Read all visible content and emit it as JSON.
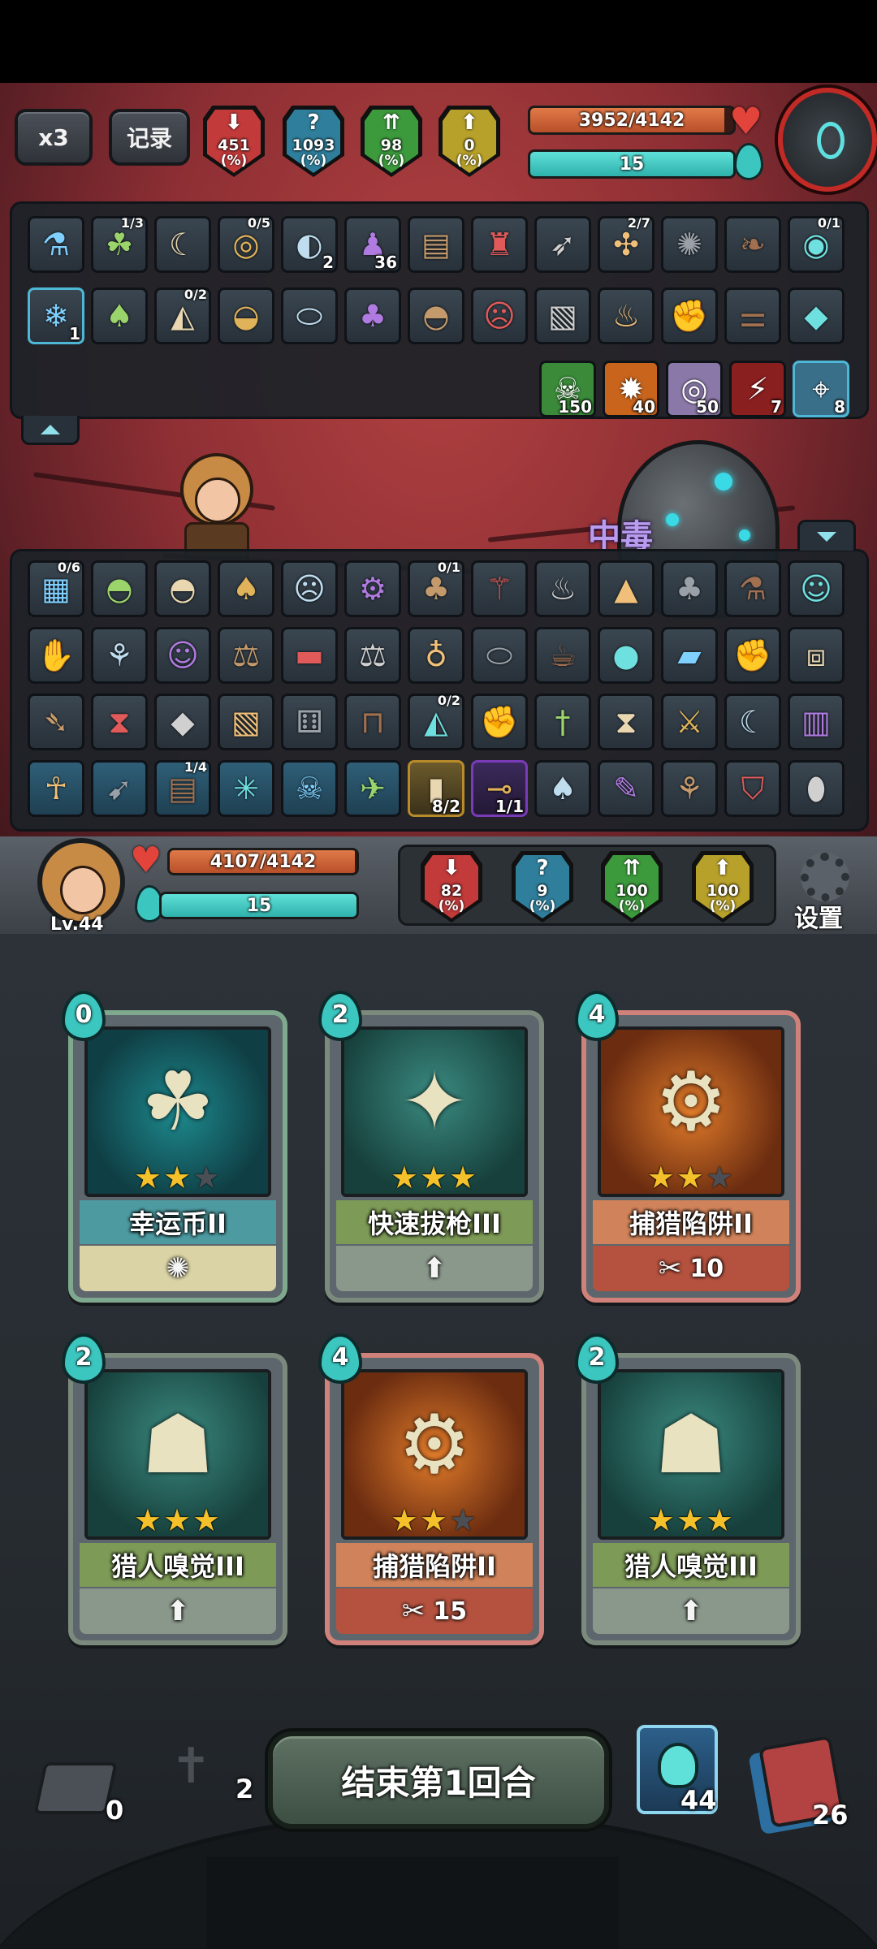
{
  "top_hud": {
    "speed_label": "x3",
    "record_label": "记录",
    "enemy_stats": [
      {
        "value": "451",
        "unit": "(%)",
        "color": "#c23a3a",
        "icon": "arrow-down-icon"
      },
      {
        "value": "1093",
        "unit": "(%)",
        "color": "#2f7f9c",
        "icon": "question-icon"
      },
      {
        "value": "98",
        "unit": "(%)",
        "color": "#3c9a3c",
        "icon": "arrows-up-icon"
      },
      {
        "value": "0",
        "unit": "(%)",
        "color": "#b8a12a",
        "icon": "arrow-up-icon"
      }
    ],
    "enemy_hp": "3952/4142",
    "enemy_hp_ratio": 0.954,
    "enemy_energy": "15",
    "enemy_energy_ratio": 1.0
  },
  "enemy_items_row1": [
    {
      "icon": "blue-potion-icon",
      "count": "",
      "frac": ""
    },
    {
      "icon": "plant-icon",
      "count": "",
      "frac": "1/3"
    },
    {
      "icon": "claw-icon",
      "count": "",
      "frac": ""
    },
    {
      "icon": "ring-icon",
      "count": "",
      "frac": "0/5"
    },
    {
      "icon": "moon-orb-icon",
      "count": "2",
      "frac": ""
    },
    {
      "icon": "purple-figure-icon",
      "count": "36",
      "frac": ""
    },
    {
      "icon": "book-icon",
      "count": "",
      "frac": ""
    },
    {
      "icon": "red-creature-icon",
      "count": "",
      "frac": ""
    },
    {
      "icon": "arrows-icon",
      "count": "",
      "frac": ""
    },
    {
      "icon": "compass-icon",
      "count": "",
      "frac": "2/7"
    },
    {
      "icon": "fan-icon",
      "count": "",
      "frac": ""
    },
    {
      "icon": "wing-icon",
      "count": "",
      "frac": ""
    },
    {
      "icon": "eye-orb-icon",
      "count": "",
      "frac": "0/1"
    }
  ],
  "enemy_items_row2": [
    {
      "icon": "snowflake-icon",
      "count": "1",
      "frac": ""
    },
    {
      "icon": "hood-icon",
      "count": "",
      "frac": ""
    },
    {
      "icon": "armor-icon",
      "count": "",
      "frac": "0/2"
    },
    {
      "icon": "bowl-icon",
      "count": "",
      "frac": ""
    },
    {
      "icon": "bread-icon",
      "count": "",
      "frac": ""
    },
    {
      "icon": "pouch-icon",
      "count": "",
      "frac": ""
    },
    {
      "icon": "helmet-icon",
      "count": "",
      "frac": ""
    },
    {
      "icon": "mask-icon",
      "count": "",
      "frac": ""
    },
    {
      "icon": "scroll-icon",
      "count": "",
      "frac": ""
    },
    {
      "icon": "fire-apple-icon",
      "count": "",
      "frac": ""
    },
    {
      "icon": "glove-icon",
      "count": "",
      "frac": ""
    },
    {
      "icon": "bone-icon",
      "count": "",
      "frac": ""
    },
    {
      "icon": "crystal-icon",
      "count": "",
      "frac": ""
    }
  ],
  "enemy_effects": [
    {
      "icon": "poison-skull-icon",
      "count": "150"
    },
    {
      "icon": "burn-icon",
      "count": "40"
    },
    {
      "icon": "vortex-icon",
      "count": "50"
    },
    {
      "icon": "bleed-icon",
      "count": "7"
    },
    {
      "icon": "target-icon",
      "count": "8"
    }
  ],
  "status_popup": "中毒",
  "player_items": [
    [
      {
        "icon": "map-icon",
        "frac": "0/6",
        "style": ""
      },
      {
        "icon": "helmet-icon",
        "frac": "",
        "style": ""
      },
      {
        "icon": "helmet-icon",
        "frac": "",
        "style": ""
      },
      {
        "icon": "hood-icon",
        "frac": "",
        "style": ""
      },
      {
        "icon": "mask-icon",
        "frac": "",
        "style": ""
      },
      {
        "icon": "gear-item-icon",
        "frac": "",
        "style": ""
      },
      {
        "icon": "sack-icon",
        "frac": "0/1",
        "style": ""
      },
      {
        "icon": "broom-icon",
        "frac": "",
        "style": ""
      },
      {
        "icon": "fire-apple-icon",
        "frac": "",
        "style": ""
      },
      {
        "icon": "rice-ball-icon",
        "frac": "",
        "style": ""
      },
      {
        "icon": "pouch-icon",
        "frac": "",
        "style": ""
      },
      {
        "icon": "blue-potion-icon",
        "frac": "",
        "style": ""
      },
      {
        "icon": "owl-icon",
        "frac": "",
        "style": ""
      }
    ],
    [
      {
        "icon": "gauntlet-icon",
        "frac": "",
        "style": ""
      },
      {
        "icon": "meat-icon",
        "frac": "",
        "style": ""
      },
      {
        "icon": "owl-icon",
        "frac": "",
        "style": ""
      },
      {
        "icon": "scale-icon",
        "frac": "",
        "style": ""
      },
      {
        "icon": "cannon-icon",
        "frac": "",
        "style": ""
      },
      {
        "icon": "scale-icon",
        "frac": "",
        "style": ""
      },
      {
        "icon": "bottle-icon",
        "frac": "",
        "style": ""
      },
      {
        "icon": "bread-icon",
        "frac": "",
        "style": ""
      },
      {
        "icon": "teapot-icon",
        "frac": "",
        "style": ""
      },
      {
        "icon": "crystal-ball-icon",
        "frac": "",
        "style": ""
      },
      {
        "icon": "board-icon",
        "frac": "",
        "style": ""
      },
      {
        "icon": "glove-icon",
        "frac": "",
        "style": ""
      },
      {
        "icon": "bag-icon",
        "frac": "",
        "style": ""
      }
    ],
    [
      {
        "icon": "fish-icon",
        "frac": "",
        "style": ""
      },
      {
        "icon": "hourglass-icon",
        "frac": "",
        "style": ""
      },
      {
        "icon": "crystal-icon",
        "frac": "",
        "style": ""
      },
      {
        "icon": "scroll-icon",
        "frac": "",
        "style": ""
      },
      {
        "icon": "dice-icon",
        "frac": "",
        "style": ""
      },
      {
        "icon": "trap-icon",
        "frac": "",
        "style": ""
      },
      {
        "icon": "armor-icon",
        "frac": "0/2",
        "style": ""
      },
      {
        "icon": "glove-red-icon",
        "frac": "",
        "style": ""
      },
      {
        "icon": "dagger-icon",
        "frac": "",
        "style": ""
      },
      {
        "icon": "hourglass-icon",
        "frac": "",
        "style": ""
      },
      {
        "icon": "sword-icon",
        "frac": "",
        "style": ""
      },
      {
        "icon": "claw-icon",
        "frac": "",
        "style": ""
      },
      {
        "icon": "bracer-icon",
        "frac": "",
        "style": ""
      }
    ],
    [
      {
        "icon": "ghost-rune-icon",
        "frac": "",
        "style": "faded"
      },
      {
        "icon": "bow-rune-icon",
        "frac": "",
        "style": "faded"
      },
      {
        "icon": "book-rune-icon",
        "frac": "1/4",
        "style": "faded"
      },
      {
        "icon": "web-rune-icon",
        "frac": "",
        "style": "faded"
      },
      {
        "icon": "skull-rune-icon",
        "frac": "",
        "style": "faded"
      },
      {
        "icon": "bird-rune-icon",
        "frac": "",
        "style": "faded"
      },
      {
        "icon": "bullet-icon",
        "frac": "",
        "count": "8/2",
        "style": "gold"
      },
      {
        "icon": "telescope-icon",
        "frac": "",
        "count": "1/1",
        "style": "purple"
      },
      {
        "icon": "mushroom-icon",
        "frac": "",
        "style": ""
      },
      {
        "icon": "brush-icon",
        "frac": "",
        "style": ""
      },
      {
        "icon": "branch-icon",
        "frac": "",
        "style": ""
      },
      {
        "icon": "shield-icon",
        "frac": "",
        "style": ""
      },
      {
        "icon": "egg-icon",
        "frac": "",
        "style": ""
      }
    ]
  ],
  "player_hud": {
    "level": "Lv.44",
    "hp": "4107/4142",
    "hp_ratio": 0.992,
    "energy": "15",
    "energy_ratio": 1.0,
    "stats": [
      {
        "value": "82",
        "unit": "(%)",
        "color": "#c23a3a",
        "icon": "arrow-down-icon"
      },
      {
        "value": "9",
        "unit": "(%)",
        "color": "#2f7f9c",
        "icon": "question-icon"
      },
      {
        "value": "100",
        "unit": "(%)",
        "color": "#3c9a3c",
        "icon": "arrows-up-icon"
      },
      {
        "value": "100",
        "unit": "(%)",
        "color": "#b8a12a",
        "icon": "arrow-up-icon"
      }
    ],
    "settings_label": "设置"
  },
  "hand_cards": [
    {
      "name": "幸运币II",
      "cost": "0",
      "stars": 2,
      "foot_value": "",
      "theme": "teal",
      "art_icon": "lucky-coin-icon",
      "foot_icon": "sparkle-icon"
    },
    {
      "name": "快速拔枪III",
      "cost": "2",
      "stars": 3,
      "foot_value": "",
      "theme": "green",
      "art_icon": "quickdraw-icon",
      "foot_icon": "up-arrow-icon"
    },
    {
      "name": "捕猎陷阱II",
      "cost": "4",
      "stars": 2,
      "foot_value": "10",
      "theme": "orange",
      "art_icon": "bear-trap-icon",
      "foot_icon": "knife-icon"
    },
    {
      "name": "猎人嗅觉III",
      "cost": "2",
      "stars": 3,
      "foot_value": "",
      "theme": "green",
      "art_icon": "hunter-sense-icon",
      "foot_icon": "up-arrow-icon"
    },
    {
      "name": "捕猎陷阱II",
      "cost": "4",
      "stars": 2,
      "foot_value": "15",
      "theme": "orange",
      "art_icon": "bear-trap-icon",
      "foot_icon": "knife-icon"
    },
    {
      "name": "猎人嗅觉III",
      "cost": "2",
      "stars": 3,
      "foot_value": "",
      "theme": "green",
      "art_icon": "hunter-sense-icon",
      "foot_icon": "up-arrow-icon"
    }
  ],
  "bottom_bar": {
    "discard_count": "0",
    "grave_count": "2",
    "end_turn_label": "结束第1回合",
    "potion_count": "44",
    "draw_count": "26"
  }
}
